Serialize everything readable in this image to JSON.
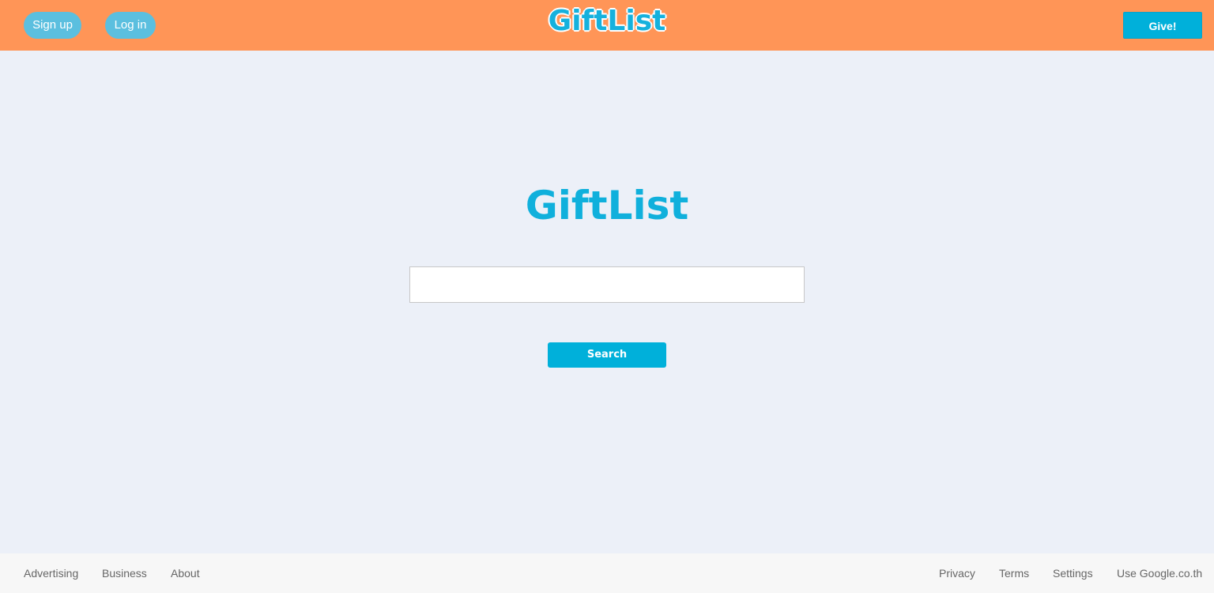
{
  "header": {
    "signup_label": "Sign up",
    "login_label": "Log in",
    "logo_text": "GiftList",
    "give_label": "Give!"
  },
  "main": {
    "logo_text": "GiftList",
    "search_value": "",
    "search_placeholder": "",
    "search_button_label": "Search"
  },
  "footer": {
    "left_links": [
      "Advertising",
      "Business",
      "About"
    ],
    "right_links": [
      "Privacy",
      "Terms",
      "Settings",
      "Use Google.co.th"
    ]
  },
  "colors": {
    "header_bg": "#ff9557",
    "page_bg": "#ecf0f8",
    "accent": "#00b0da",
    "pill_btn": "#5bbfdf",
    "footer_bg": "#f7f7f7"
  }
}
